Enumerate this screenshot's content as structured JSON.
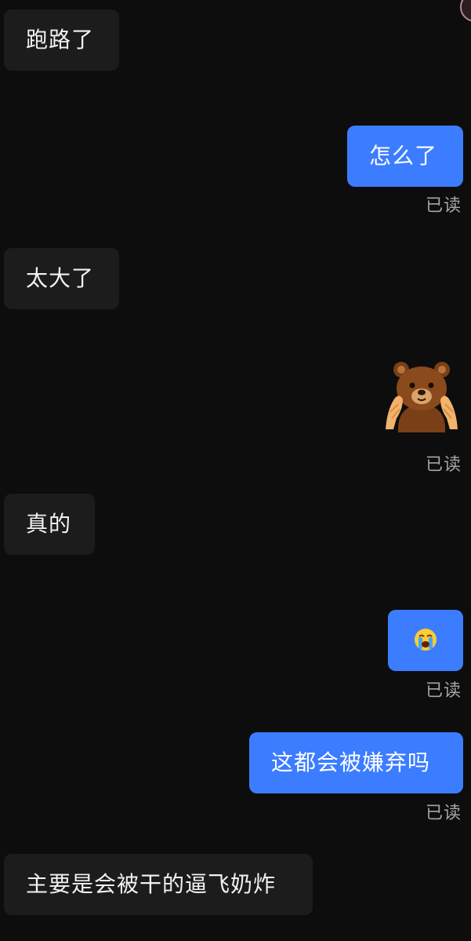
{
  "messages": [
    {
      "side": "in",
      "text": "跑路了"
    },
    {
      "side": "out",
      "text": "怎么了",
      "status": "已读"
    },
    {
      "side": "in",
      "text": "太大了"
    },
    {
      "side": "out",
      "type": "sticker",
      "sticker": "bear-cheeks-sticker",
      "status": "已读"
    },
    {
      "side": "in",
      "text": "真的"
    },
    {
      "side": "out",
      "type": "emoji",
      "emoji": "loudly-crying-face-emoji",
      "status": "已读"
    },
    {
      "side": "out",
      "text": "这都会被嫌弃吗",
      "status": "已读"
    },
    {
      "side": "in",
      "text": "主要是会被干的逼飞奶炸"
    }
  ],
  "colors": {
    "background": "#0d0d0d",
    "incoming_bubble": "#1c1c1c",
    "outgoing_bubble": "#3c7dff",
    "read_status": "#a6a6a6"
  }
}
